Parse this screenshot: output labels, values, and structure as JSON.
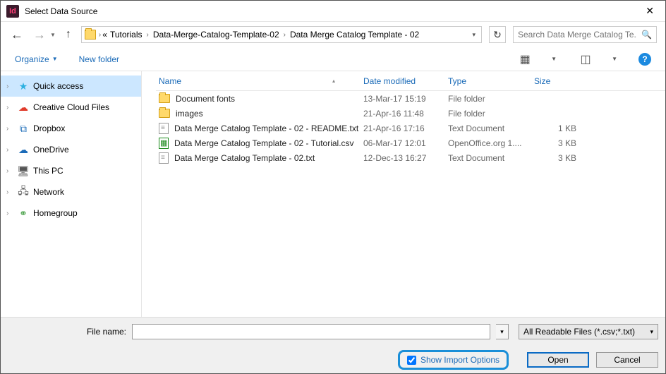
{
  "titlebar": {
    "app_glyph": "Id",
    "title": "Select Data Source"
  },
  "address": {
    "crumbs": [
      "Tutorials",
      "Data-Merge-Catalog-Template-02",
      "Data Merge Catalog Template - 02"
    ]
  },
  "search": {
    "placeholder": "Search Data Merge Catalog Te..."
  },
  "toolbar": {
    "organize": "Organize",
    "new_folder": "New folder"
  },
  "sidebar": {
    "items": [
      {
        "label": "Quick access",
        "icon": "★",
        "color": "#2cb0e0",
        "selected": true
      },
      {
        "label": "Creative Cloud Files",
        "icon": "☁",
        "color": "#e03c2c"
      },
      {
        "label": "Dropbox",
        "icon": "⧉",
        "color": "#1b6bb8"
      },
      {
        "label": "OneDrive",
        "icon": "☁",
        "color": "#1b6bb8"
      },
      {
        "label": "This PC",
        "icon": "🖥",
        "color": "#555"
      },
      {
        "label": "Network",
        "icon": "🖧",
        "color": "#555"
      },
      {
        "label": "Homegroup",
        "icon": "⚭",
        "color": "#3a9a3a"
      }
    ]
  },
  "columns": {
    "name": "Name",
    "date": "Date modified",
    "type": "Type",
    "size": "Size"
  },
  "rows": [
    {
      "kind": "folder",
      "name": "Document fonts",
      "date": "13-Mar-17 15:19",
      "type": "File folder",
      "size": ""
    },
    {
      "kind": "folder",
      "name": "images",
      "date": "21-Apr-16 11:48",
      "type": "File folder",
      "size": ""
    },
    {
      "kind": "txt",
      "name": "Data Merge Catalog Template - 02 - README.txt",
      "date": "21-Apr-16 17:16",
      "type": "Text Document",
      "size": "1 KB"
    },
    {
      "kind": "csv",
      "name": "Data Merge Catalog Template - 02 - Tutorial.csv",
      "date": "06-Mar-17 12:01",
      "type": "OpenOffice.org 1....",
      "size": "3 KB"
    },
    {
      "kind": "txt",
      "name": "Data Merge Catalog Template - 02.txt",
      "date": "12-Dec-13 16:27",
      "type": "Text Document",
      "size": "3 KB"
    }
  ],
  "footer": {
    "filename_label": "File name:",
    "filter": "All Readable Files (*.csv;*.txt)",
    "import_label": "Show Import Options",
    "open": "Open",
    "cancel": "Cancel"
  }
}
